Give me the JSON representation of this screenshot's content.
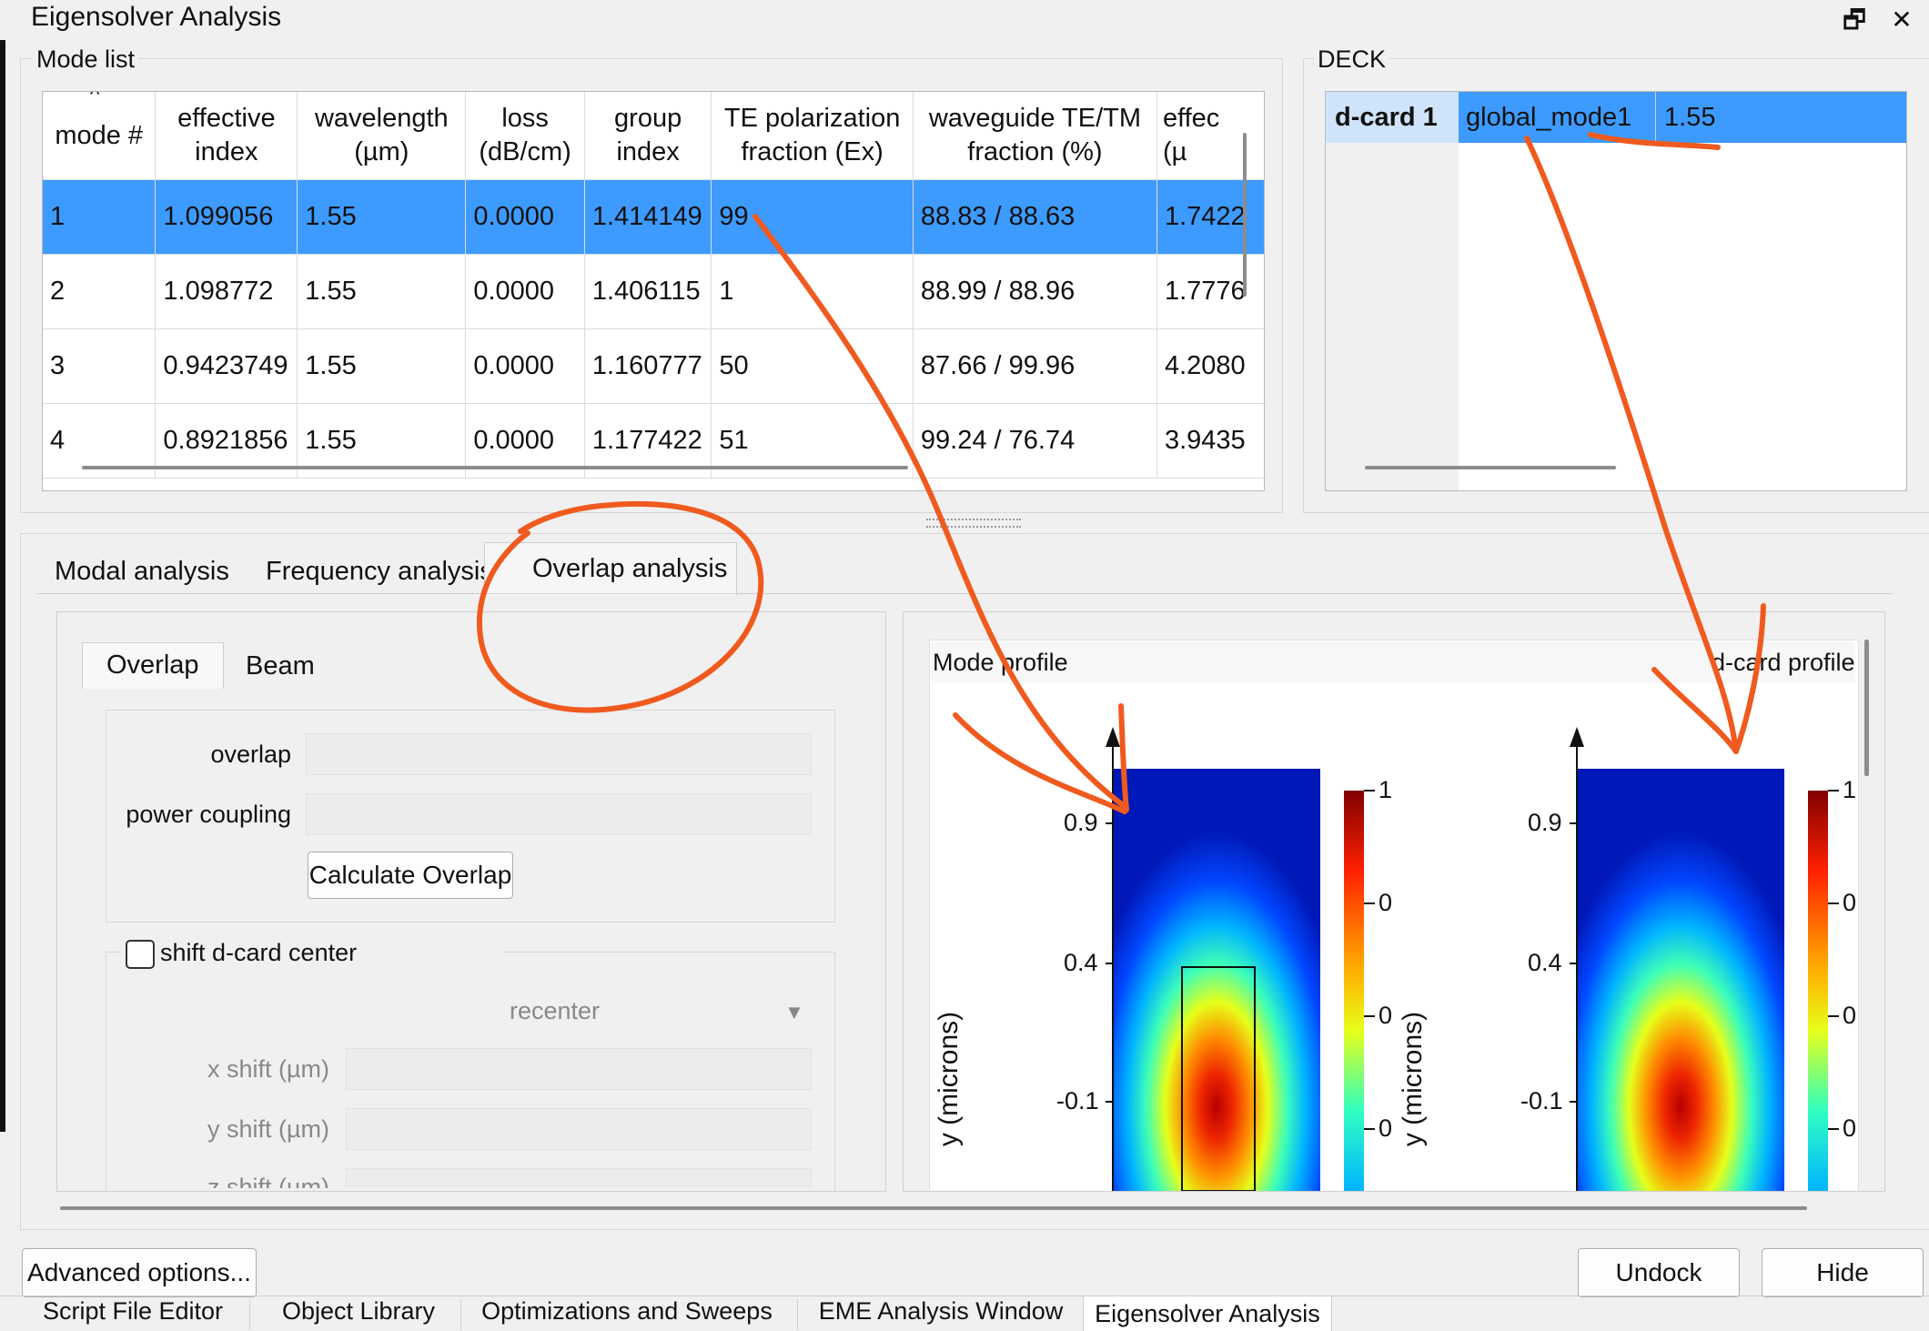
{
  "window": {
    "title": "Eigensolver Analysis",
    "restore_icon": "restore-window-icon",
    "close_icon": "close-icon"
  },
  "mode_list": {
    "title": "Mode list",
    "columns": [
      {
        "l1": "mode #",
        "l2": ""
      },
      {
        "l1": "effective",
        "l2": "index"
      },
      {
        "l1": "wavelength",
        "l2": "(µm)"
      },
      {
        "l1": "loss",
        "l2": "(dB/cm)"
      },
      {
        "l1": "group",
        "l2": "index"
      },
      {
        "l1": "TE polarization",
        "l2": "fraction (Ex)"
      },
      {
        "l1": "waveguide TE/TM",
        "l2": "fraction (%)"
      },
      {
        "l1": "effec",
        "l2": "(µ"
      }
    ],
    "rows": [
      [
        "1",
        "1.099056",
        "1.55",
        "0.0000",
        "1.414149",
        "99",
        "88.83 / 88.63",
        "1.7422"
      ],
      [
        "2",
        "1.098772",
        "1.55",
        "0.0000",
        "1.406115",
        "1",
        "88.99 / 88.96",
        "1.7776"
      ],
      [
        "3",
        "0.9423749",
        "1.55",
        "0.0000",
        "1.160777",
        "50",
        "87.66 / 99.96",
        "4.2080"
      ],
      [
        "4",
        "0.8921856",
        "1.55",
        "0.0000",
        "1.177422",
        "51",
        "99.24 / 76.74",
        "3.9435"
      ]
    ]
  },
  "deck": {
    "title": "DECK",
    "row": [
      "d-card 1",
      "global_mode1",
      "1.55"
    ]
  },
  "tabs": [
    "Modal analysis",
    "Frequency analysis",
    "Overlap analysis"
  ],
  "subtabs": [
    "Overlap",
    "Beam"
  ],
  "overlap": {
    "overlap_label": "overlap",
    "power_label": "power coupling",
    "calc_button": "Calculate Overlap"
  },
  "shift": {
    "checkbox_label": "shift d-card center",
    "dropdown_value": "recenter",
    "x_label": "x shift (µm)",
    "y_label": "y shift (µm)",
    "z_label": "z shift (µm)"
  },
  "plots": {
    "mode_title": "Mode profile",
    "dcard_title": "d-card profile",
    "ylabel": "y (microns)",
    "yticks": [
      "0.9",
      "0.4",
      "-0.1"
    ],
    "cbar_ticks": [
      "1",
      "0",
      "0",
      "0"
    ]
  },
  "bottom": {
    "advanced": "Advanced options...",
    "undock": "Undock",
    "hide": "Hide"
  },
  "bottom_tabs": [
    "Script File Editor",
    "Object Library",
    "Optimizations and Sweeps",
    "EME Analysis Window",
    "Eigensolver Analysis"
  ],
  "colors": {
    "selection": "#3d9bff",
    "annotation": "#f05a1e"
  }
}
